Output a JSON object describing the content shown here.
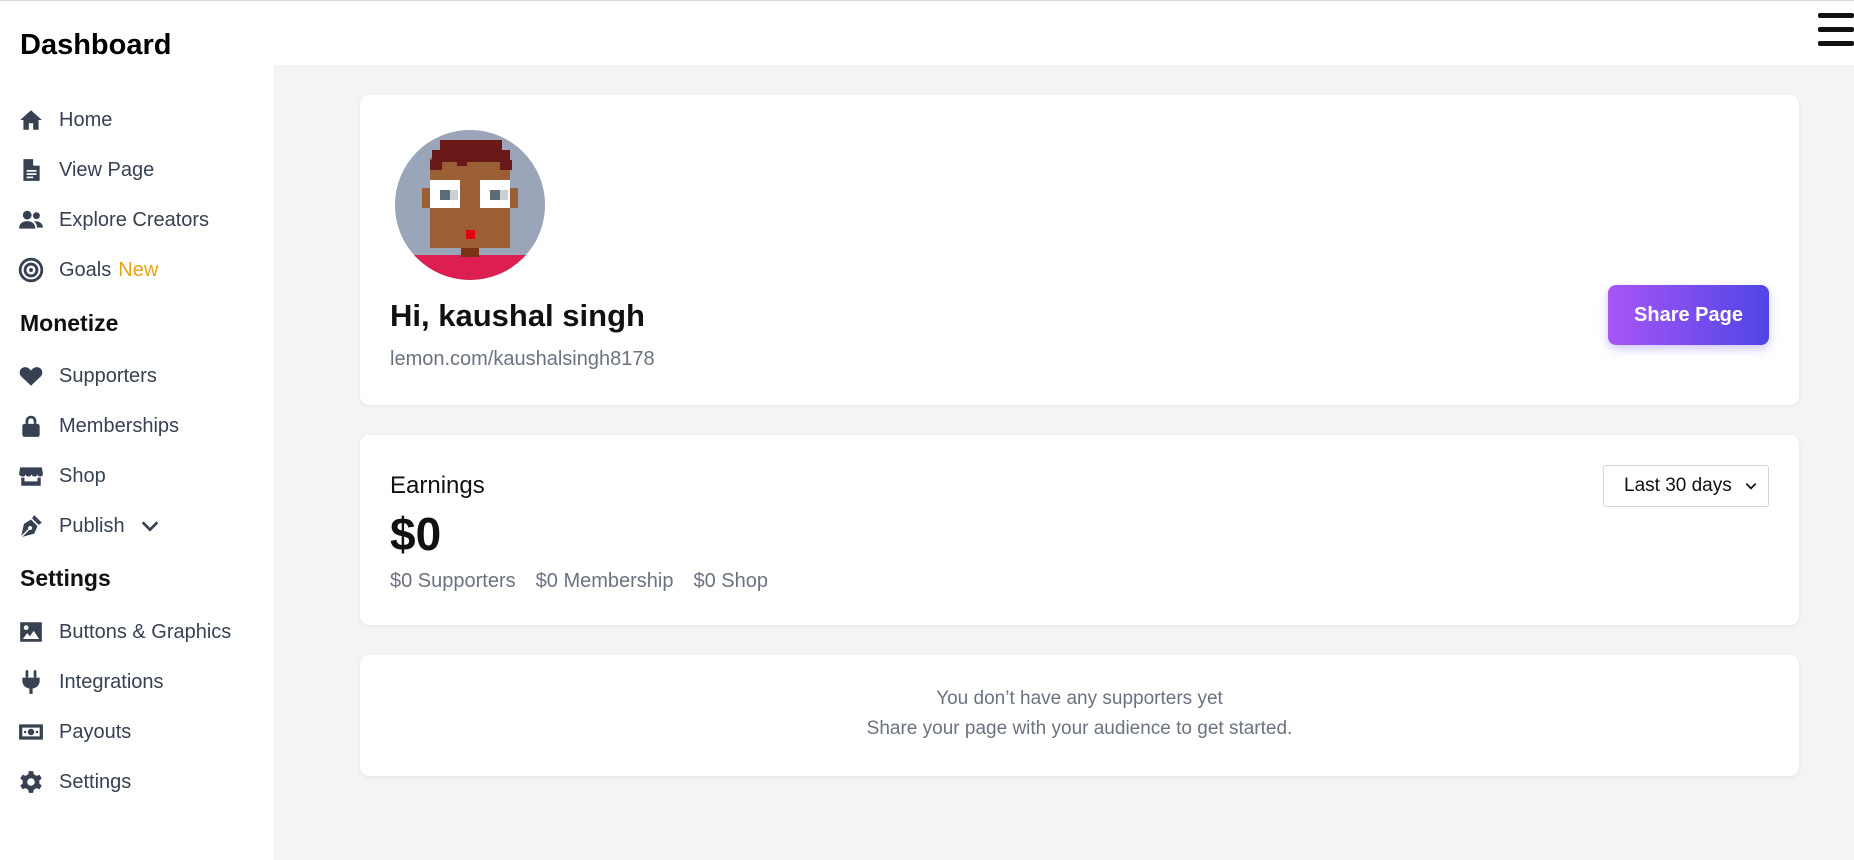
{
  "sidebar": {
    "brand": "Dashboard",
    "main_items": [
      {
        "label": "Home",
        "icon": "home-icon"
      },
      {
        "label": "View Page",
        "icon": "file-icon"
      },
      {
        "label": "Explore Creators",
        "icon": "users-icon"
      },
      {
        "label": "Goals",
        "icon": "target-icon",
        "badge": "New"
      }
    ],
    "monetize_title": "Monetize",
    "monetize_items": [
      {
        "label": "Supporters",
        "icon": "heart-icon"
      },
      {
        "label": "Memberships",
        "icon": "lock-icon"
      },
      {
        "label": "Shop",
        "icon": "store-icon"
      },
      {
        "label": "Publish",
        "icon": "pen-icon"
      }
    ],
    "settings_title": "Settings",
    "settings_items": [
      {
        "label": "Buttons & Graphics",
        "icon": "image-icon"
      },
      {
        "label": "Integrations",
        "icon": "plug-icon"
      },
      {
        "label": "Payouts",
        "icon": "money-icon"
      },
      {
        "label": "Settings",
        "icon": "gear-icon"
      }
    ]
  },
  "profile": {
    "greeting": "Hi, kaushal singh",
    "page_url": "lemon.com/kaushalsingh8178",
    "share_label": "Share Page"
  },
  "earnings": {
    "title": "Earnings",
    "total": "$0",
    "supporters": "$0 Supporters",
    "membership": "$0 Membership",
    "shop": "$0 Shop",
    "range": "Last 30 days"
  },
  "empty_state": {
    "line1": "You don’t have any supporters yet",
    "line2": "Share your page with your audience to get started."
  },
  "colors": {
    "accent_start": "#a855f7",
    "accent_end": "#4f46e5",
    "badge": "#e8a317"
  }
}
